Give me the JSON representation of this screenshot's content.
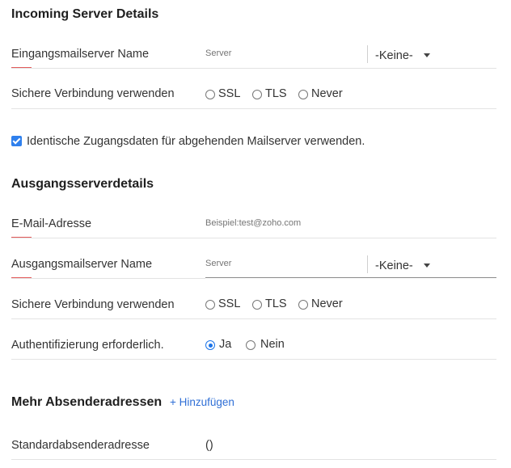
{
  "incoming": {
    "title": "Incoming Server Details",
    "server_name_label": "Eingangsmailserver Name",
    "server_placeholder": "Server",
    "encryption_value": "-Keine-",
    "secure_label": "Sichere Verbindung verwenden",
    "options": [
      "SSL",
      "TLS",
      "Never"
    ]
  },
  "same_credentials": {
    "label": "Identische Zugangsdaten für abgehenden Mailserver verwenden.",
    "checked": true
  },
  "outgoing": {
    "title": "Ausgangsserverdetails",
    "email_label": "E-Mail-Adresse",
    "email_placeholder": "Beispiel:test@zoho.com",
    "server_name_label": "Ausgangsmailserver Name",
    "server_placeholder": "Server",
    "encryption_value": "-Keine-",
    "secure_label": "Sichere Verbindung verwenden",
    "options": [
      "SSL",
      "TLS",
      "Never"
    ],
    "auth_label": "Authentifizierung erforderlich.",
    "auth_options": [
      "Ja",
      "Nein"
    ],
    "auth_selected": "Ja"
  },
  "senders": {
    "title": "Mehr Absenderadressen",
    "add_link": "+ Hinzufügen",
    "default_label": "Standardabsenderadresse",
    "default_value": "()"
  },
  "colors": {
    "accent": "#1a73e8",
    "required": "#e35a5a",
    "link": "#2f6fd6"
  }
}
